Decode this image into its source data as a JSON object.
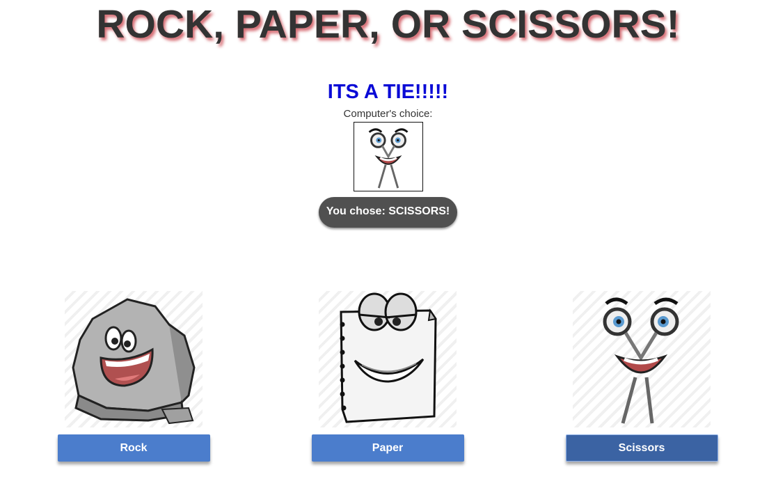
{
  "title": "ROCK, PAPER, OR SCISSORS!",
  "result": {
    "message": "ITS A TIE!!!!!",
    "computer_label": "Computer's choice:",
    "computer_choice_icon": "scissors-character-icon",
    "user_choice": "You chose: SCISSORS!"
  },
  "choices": [
    {
      "label": "Rock",
      "icon": "rock-character-icon"
    },
    {
      "label": "Paper",
      "icon": "paper-character-icon"
    },
    {
      "label": "Scissors",
      "icon": "scissors-character-icon",
      "selected": true
    }
  ],
  "colors": {
    "title": "#333333",
    "title_shadow": "#c83c46",
    "result": "#0a0ad6",
    "button": "#4b7dcc",
    "button_selected": "#3b63a3",
    "pill": "#505050"
  }
}
